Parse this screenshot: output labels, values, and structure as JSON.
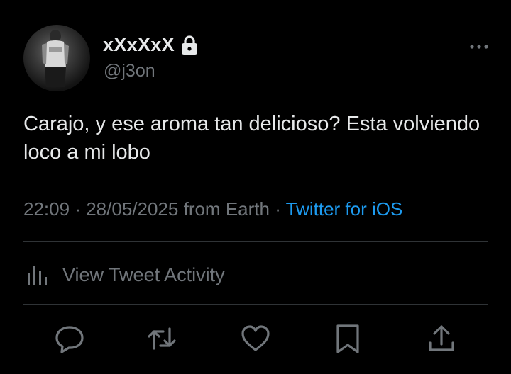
{
  "user": {
    "display_name": "xXxXxX",
    "handle": "@j3on",
    "avatar_icon": "profile-photo",
    "protected_icon": "lock-icon"
  },
  "tweet": {
    "text": "Carajo, y ese aroma tan delicioso? Esta volviendo loco a mi lobo",
    "time": "22:09",
    "date": "28/05/2025",
    "location": "from Earth",
    "separator": "·",
    "client": "Twitter for iOS"
  },
  "activity": {
    "label": "View Tweet Activity",
    "icon": "analytics-bars-icon"
  },
  "actions": [
    {
      "name": "reply",
      "icon": "reply-bubble-icon"
    },
    {
      "name": "retweet",
      "icon": "retweet-icon"
    },
    {
      "name": "like",
      "icon": "heart-icon"
    },
    {
      "name": "bookmark",
      "icon": "bookmark-icon"
    },
    {
      "name": "share",
      "icon": "share-icon"
    }
  ],
  "colors": {
    "background": "#000000",
    "primary_text": "#e7e9ea",
    "secondary_text": "#71767b",
    "link": "#1d9bf0",
    "divider": "#2f3336"
  }
}
